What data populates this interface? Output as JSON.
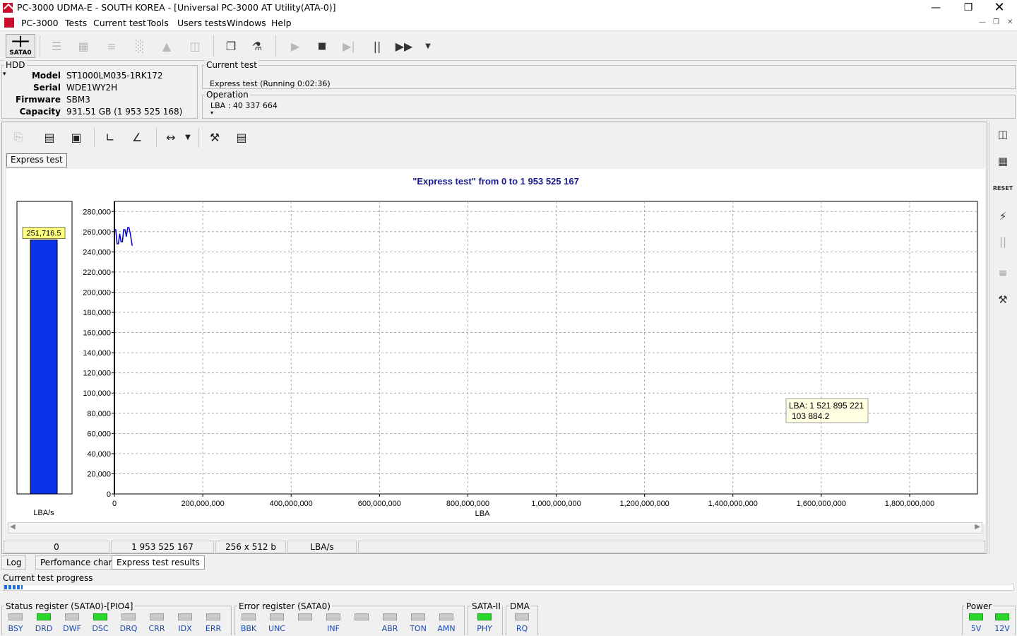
{
  "window": {
    "title": "PC-3000 UDMA-E - SOUTH KOREA - [Universal PC-3000 AT Utility(ATA-0)]",
    "minimize_icon": "minimize-icon",
    "maximize_icon": "restore-icon",
    "close_icon": "close-icon"
  },
  "menu": [
    "PC-3000",
    "Tests",
    "Current test",
    "Tools",
    "Users tests",
    "Windows",
    "Help"
  ],
  "toolbar": {
    "sata_label": "SATA0"
  },
  "hdd": {
    "group_title": "HDD",
    "labels": {
      "model": "Model",
      "serial": "Serial",
      "firmware": "Firmware",
      "capacity": "Capacity"
    },
    "model": "ST1000LM035-1RK172",
    "serial": "WDE1WY2H",
    "firmware": "SBM3",
    "capacity": "931.51 GB (1 953 525 168)"
  },
  "current_test": {
    "group_title": "Current test",
    "status": "Express test (Running 0:02:36)"
  },
  "operation": {
    "group_title": "Operation",
    "lba": "LBA : 40 337 664"
  },
  "tab": {
    "label": "Express test"
  },
  "chart_data": {
    "type": "line",
    "title": "\"Express test\" from 0 to 1 953 525 167",
    "xlabel": "LBA",
    "ylabel": "LBA/s",
    "xlim": [
      0,
      1953525167
    ],
    "ylim": [
      0,
      290000
    ],
    "x_ticks": [
      "0",
      "200,000,000",
      "400,000,000",
      "600,000,000",
      "800,000,000",
      "1,000,000,000",
      "1,200,000,000",
      "1,400,000,000",
      "1,600,000,000",
      "1,800,000,000"
    ],
    "y_ticks": [
      "0",
      "20,000",
      "40,000",
      "60,000",
      "80,000",
      "100,000",
      "120,000",
      "140,000",
      "160,000",
      "180,000",
      "200,000",
      "220,000",
      "240,000",
      "260,000",
      "280,000"
    ],
    "grid": true,
    "series": [
      {
        "color": "#0000cc",
        "x": [
          0,
          3000000,
          6000000,
          9000000,
          12000000,
          15000000,
          18000000,
          21000000,
          24000000,
          27000000,
          30000000,
          33000000,
          36000000,
          40337664
        ],
        "y": [
          262000,
          262000,
          248000,
          248000,
          258000,
          250000,
          250000,
          262000,
          262000,
          255000,
          264000,
          264000,
          258000,
          246000
        ]
      }
    ],
    "gauge": {
      "value": 251716.5,
      "label": "251,716.5",
      "unit": "LBA/s"
    },
    "tooltip": {
      "line1": "LBA: 1 521 895 221",
      "line2": "103 884.2"
    }
  },
  "status_row": [
    "0",
    "1 953 525 167",
    "256 x 512 b",
    "LBA/s"
  ],
  "bottom_tabs": [
    "Log",
    "Perfomance chart",
    "Express test results"
  ],
  "progress": {
    "label": "Current test progress",
    "fraction": 0.018
  },
  "status_register": {
    "title": "Status register (SATA0)-[PIO4]",
    "bits": [
      {
        "name": "BSY",
        "on": false
      },
      {
        "name": "DRD",
        "on": true
      },
      {
        "name": "DWF",
        "on": false
      },
      {
        "name": "DSC",
        "on": true
      },
      {
        "name": "DRQ",
        "on": false
      },
      {
        "name": "CRR",
        "on": false
      },
      {
        "name": "IDX",
        "on": false
      },
      {
        "name": "ERR",
        "on": false
      }
    ]
  },
  "error_register": {
    "title": "Error register (SATA0)",
    "bits": [
      {
        "name": "BBK",
        "on": false
      },
      {
        "name": "UNC",
        "on": false
      },
      {
        "name": "",
        "on": false
      },
      {
        "name": "INF",
        "on": false
      },
      {
        "name": "",
        "on": false
      },
      {
        "name": "ABR",
        "on": false
      },
      {
        "name": "TON",
        "on": false
      },
      {
        "name": "AMN",
        "on": false
      }
    ]
  },
  "sata2": {
    "title": "SATA-II",
    "bits": [
      {
        "name": "PHY",
        "on": true
      }
    ]
  },
  "dma": {
    "title": "DMA",
    "bits": [
      {
        "name": "RQ",
        "on": false
      }
    ]
  },
  "power": {
    "title": "Power",
    "bits": [
      {
        "name": "5V",
        "on": true
      },
      {
        "name": "12V",
        "on": true
      }
    ]
  }
}
